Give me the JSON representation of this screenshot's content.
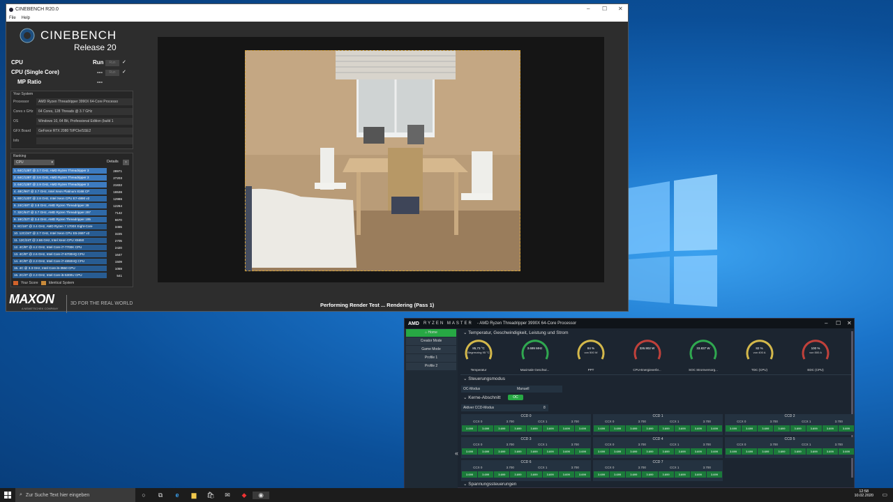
{
  "cinebench": {
    "window_title": "CINEBENCH R20.0",
    "menu": [
      "File",
      "Help"
    ],
    "logo_name": "CINEBENCH",
    "logo_release": "Release 20",
    "cpu_label": "CPU",
    "cpu_run": "Run",
    "cpu_btn": "Run",
    "single_label": "CPU (Single Core)",
    "single_value": "---",
    "single_btn": "Run",
    "mp_label": "MP Ratio",
    "mp_value": "---",
    "system_title": "Your System",
    "system": [
      {
        "k": "Processor",
        "v": "AMD Ryzen Threadripper 3990X 64-Core Processo"
      },
      {
        "k": "Cores x GHz",
        "v": "64 Cores, 128 Threads @ 3.7 GHz"
      },
      {
        "k": "OS",
        "v": "Windows 10, 64 Bit, Professional Edition (build 1"
      },
      {
        "k": "GFX Board",
        "v": "GeForce RTX 2080 Ti/PCIe/SSE2"
      },
      {
        "k": "Info",
        "v": ""
      }
    ],
    "ranking_title": "Ranking",
    "ranking_select": "CPU",
    "details": "Details",
    "ranking": [
      {
        "t": "1. 64C/128T @ 3.7 GHz, AMD Ryzen Threadripper 3",
        "s": "28971"
      },
      {
        "t": "2. 64C/128T @ 3.6 GHz, AMD Ryzen Threadripper 3",
        "s": "27203"
      },
      {
        "t": "3. 64C/128T @ 2.9 GHz, AMD Ryzen Threadripper 3",
        "s": "21832"
      },
      {
        "t": "4. 48C/96T @ 2.7 GHz, Intel Xeon Platinum 8168 CP",
        "s": "16536"
      },
      {
        "t": "5. 60C/120T @ 2.8 GHz, Intel Xeon CPU E7-4890 v2",
        "s": "12986"
      },
      {
        "t": "6. 24C/48T @ 3.8 GHz, AMD Ryzen Threadripper 39",
        "s": "12264"
      },
      {
        "t": "7. 32C/64T @ 3.7 GHz, AMD Ryzen Threadripper 297",
        "s": "7142"
      },
      {
        "t": "8. 16C/32T @ 3.4 GHz, AMD Ryzen Threadripper 195",
        "s": "6670"
      },
      {
        "t": "9. 8C/16T @ 3.4 GHz, AMD Ryzen 7 1700X Eight-Core",
        "s": "3455"
      },
      {
        "t": "10. 12C/24T @ 2.7 GHz, Intel Xeon CPU E5-2697 v2",
        "s": "3225"
      },
      {
        "t": "11. 12C/24T @ 2.66 GHz, Intel Xeon CPU X5650",
        "s": "2705"
      },
      {
        "t": "12. 4C/8T @ 4.2 GHz, Intel Core i7-7700K CPU",
        "s": "2420"
      },
      {
        "t": "13. 4C/8T @ 2.6 GHz, Intel Core i7-6700HQ CPU",
        "s": "1647"
      },
      {
        "t": "14. 4C/8T @ 2.3 GHz, Intel Core i7-4850HQ CPU",
        "s": "1509"
      },
      {
        "t": "15. 4C @ 3.3 GHz, Intel Core i5-3550 CPU",
        "s": "1059"
      },
      {
        "t": "16. 2C/4T @ 2.3 GHz, Intel Core i5-5300U CPU",
        "s": "541"
      }
    ],
    "legend_your": "Your Score",
    "legend_identical": "Identical System",
    "maxon": "MAXON",
    "maxon_sub": "A NEMETSCHEK COMPANY",
    "tagline": "3D FOR THE REAL WORLD",
    "status": "Performing Render Test ... Rendering (Pass 1)"
  },
  "ryzen": {
    "brand": "AMD",
    "app": "RYZEN MASTER",
    "title": "- AMD Ryzen Threadripper 3990X 64-Core Processor",
    "nav": [
      "Home",
      "Creator Mode",
      "Game Mode",
      "Profile 1",
      "Profile 2"
    ],
    "sec_temp": "Temperatur, Geschwindigkeit, Leistung und Strom",
    "gauges": [
      {
        "v": "85,73 °C",
        "v2": "Begrenzing 95 °C",
        "lab": "Temperatur",
        "color": "#d4b84a"
      },
      {
        "v": "3.699 MHz",
        "v2": "",
        "lab": "Maximale Geschwi...",
        "color": "#2fa84f"
      },
      {
        "v": "84 %",
        "v2": "von 500 W",
        "lab": "PPT",
        "color": "#d4b84a"
      },
      {
        "v": "326.902 W",
        "v2": "",
        "lab": "CPU-Energieverbr...",
        "color": "#c0403a"
      },
      {
        "v": "33.837 W",
        "v2": "",
        "lab": "SOC Stromversorg...",
        "color": "#2fa84f"
      },
      {
        "v": "82 %",
        "v2": "von 400 A",
        "lab": "TDC (CPU)",
        "color": "#d4b84a"
      },
      {
        "v": "100 %",
        "v2": "von 500 A",
        "lab": "EDC (CPU)",
        "color": "#c0403a"
      }
    ],
    "sec_control": "Steuerungsmodus",
    "oc_mode_label": "OC-Modus",
    "oc_mode_value": "Manuell",
    "sec_cores": "Kerne-Abschnitt",
    "oc_badge": "OC",
    "ccd_mode_label": "Aktiver CCD-Modus",
    "ccd_mode_value": "8",
    "ccds": [
      "CCD 0",
      "CCD 1",
      "CCD 2",
      "CCD 3",
      "CCD 4",
      "CCD 5",
      "CCD 6",
      "CCD 7"
    ],
    "ccx0": "CCX 0",
    "ccx1": "CCX 1",
    "ccx_speed": "3.700",
    "core_speed": "3.699",
    "sec_voltage": "Spannungssteuerungen",
    "collapse": "«"
  },
  "taskbar": {
    "search_placeholder": "Zur Suche Text hier eingeben",
    "time": "12:58",
    "date": "10.02.2020"
  }
}
